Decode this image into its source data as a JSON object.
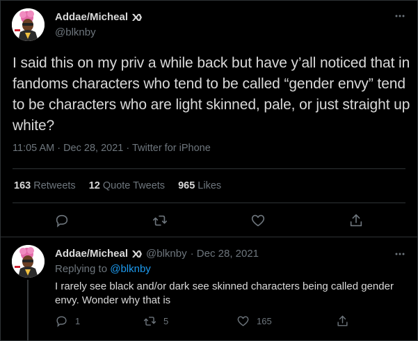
{
  "tweet": {
    "author_name": "Addae/Micheal",
    "author_handle": "@blknby",
    "text": "I said this on my priv a while back but have y’all noticed that in fandoms characters who tend to be called “gender envy” tend to be characters who are light skinned, pale, or just straight up white?",
    "timestamp": "11:05 AM · Dec 28, 2021 · Twitter for iPhone",
    "stats": {
      "retweets_count": "163",
      "retweets_label": "Retweets",
      "quotes_count": "12",
      "quotes_label": "Quote Tweets",
      "likes_count": "965",
      "likes_label": "Likes"
    },
    "actions": [
      "reply-icon",
      "retweet-icon",
      "like-icon",
      "share-icon"
    ]
  },
  "reply": {
    "author_name": "Addae/Micheal",
    "author_handle": "@blknby",
    "date": "· Dec 28, 2021",
    "replying_label": "Replying to",
    "replying_to": "@blknby",
    "text": "I rarely see black and/or dark see skinned characters being called gender envy. Wonder why that is",
    "reply_count": "1",
    "retweet_count": "5",
    "like_count": "165"
  },
  "colors": {
    "background": "#000000",
    "text": "#d9d9d9",
    "muted": "#6e767d",
    "link": "#1d9bf0",
    "border": "#2f3336"
  }
}
